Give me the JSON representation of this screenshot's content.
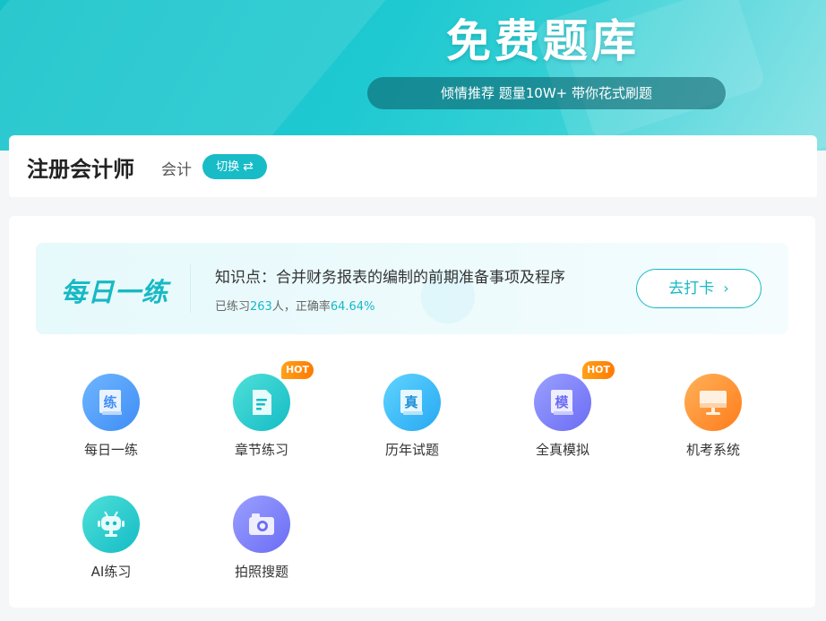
{
  "hero": {
    "title": "免费题库",
    "subtitle": "倾情推荐 题量10W+ 带你花式刷题"
  },
  "exam": {
    "name": "注册会计师",
    "subject": "会计",
    "switch_label": "切换",
    "switch_icon": "swap-arrows-icon"
  },
  "daily": {
    "title": "每日一练",
    "topic": "知识点：合并财务报表的编制的前期准备事项及程序",
    "stats_prefix": "已练习",
    "stats_count": "263",
    "stats_mid": "人，正确率",
    "stats_rate": "64.64%",
    "checkin_label": "去打卡",
    "checkin_icon": "chevron-right-icon"
  },
  "features": [
    {
      "label": "每日一练",
      "icon": "practice-book-icon",
      "hot": false,
      "glyph": "练"
    },
    {
      "label": "章节练习",
      "icon": "document-icon",
      "hot": true,
      "hot_label": "HOT"
    },
    {
      "label": "历年试题",
      "icon": "exam-paper-icon",
      "hot": false,
      "glyph": "真"
    },
    {
      "label": "全真模拟",
      "icon": "mock-exam-icon",
      "hot": true,
      "hot_label": "HOT",
      "glyph": "模"
    },
    {
      "label": "机考系统",
      "icon": "computer-icon",
      "hot": false
    },
    {
      "label": "AI练习",
      "icon": "robot-icon",
      "hot": false
    },
    {
      "label": "拍照搜题",
      "icon": "camera-icon",
      "hot": false
    }
  ],
  "colors": {
    "accent": "#17b9c4",
    "hot": "#ff8a00"
  }
}
